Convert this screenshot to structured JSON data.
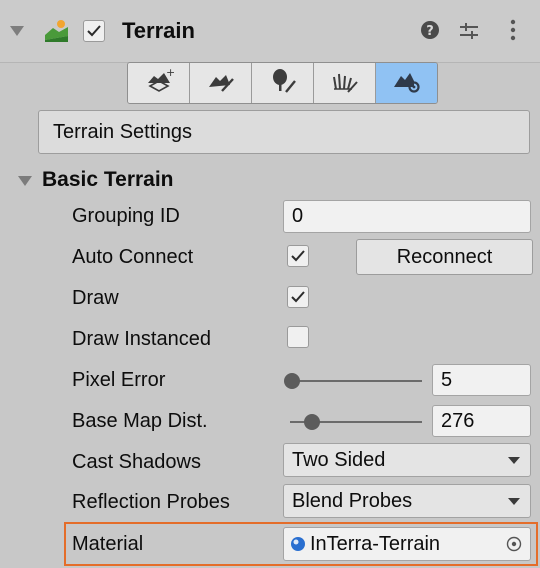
{
  "component": {
    "title": "Terrain",
    "enabled": true
  },
  "toolbar": {
    "tools": [
      {
        "name": "create-neighbor-terrains-icon",
        "active": false
      },
      {
        "name": "paint-terrain-icon",
        "active": false
      },
      {
        "name": "paint-trees-icon",
        "active": false
      },
      {
        "name": "paint-details-icon",
        "active": false
      },
      {
        "name": "terrain-settings-icon",
        "active": true
      }
    ]
  },
  "settings_bar": {
    "label": "Terrain Settings"
  },
  "basic_terrain": {
    "title": "Basic Terrain",
    "grouping_id": {
      "label": "Grouping ID",
      "value": "0"
    },
    "auto_connect": {
      "label": "Auto Connect",
      "checked": true,
      "button": "Reconnect"
    },
    "draw": {
      "label": "Draw",
      "checked": true
    },
    "draw_instanced": {
      "label": "Draw Instanced",
      "checked": false
    },
    "pixel_error": {
      "label": "Pixel Error",
      "value": "5",
      "fraction": 0.0
    },
    "base_map_dist": {
      "label": "Base Map Dist.",
      "value": "276",
      "fraction": 0.18
    },
    "cast_shadows": {
      "label": "Cast Shadows",
      "value": "Two Sided"
    },
    "reflection_probes": {
      "label": "Reflection Probes",
      "value": "Blend Probes"
    },
    "material": {
      "label": "Material",
      "value": "InTerra-Terrain"
    }
  },
  "colors": {
    "accent": "#90c2f3",
    "highlight": "#e46d2a"
  }
}
